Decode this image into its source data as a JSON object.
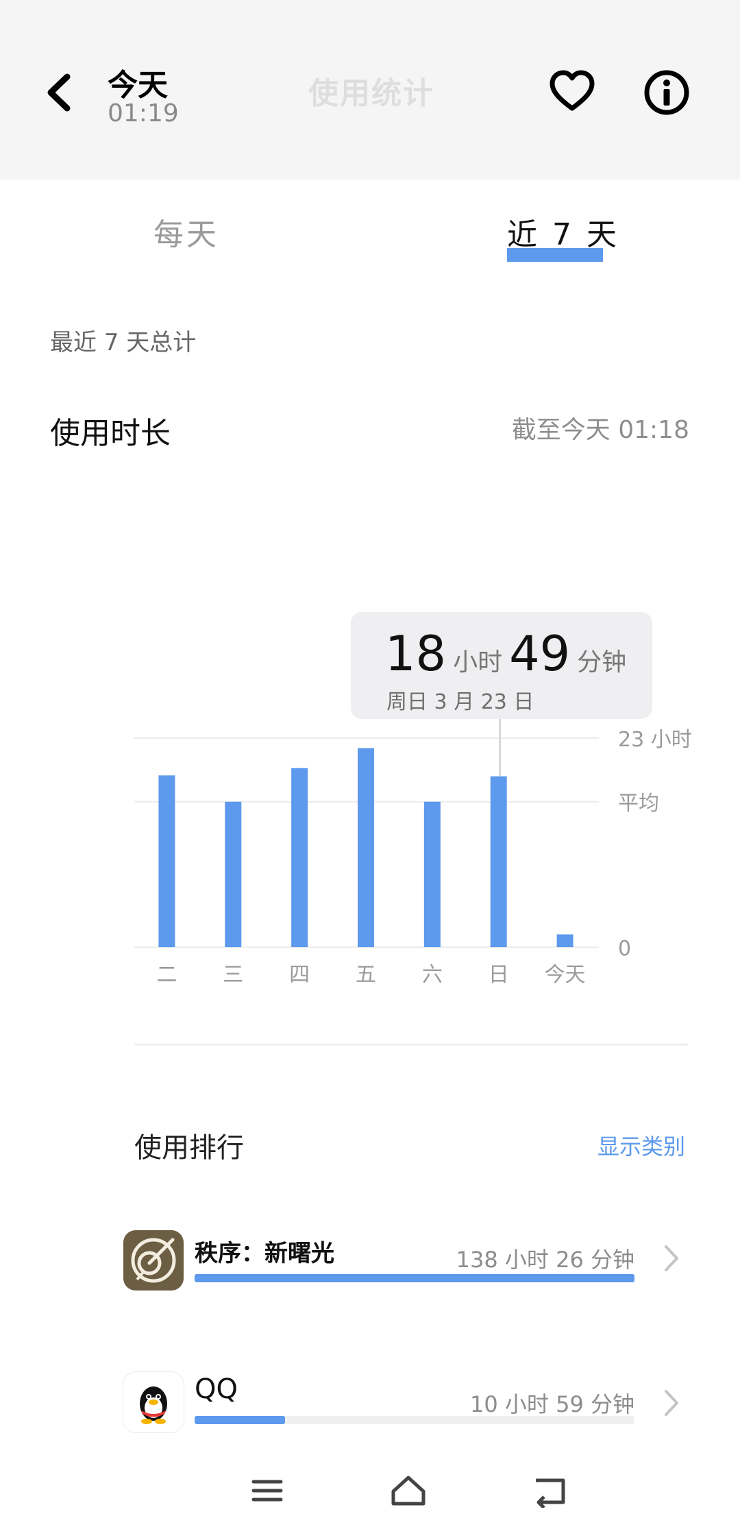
{
  "header": {
    "title": "今天",
    "time": "01:19",
    "center_title": "使用统计"
  },
  "tabs": [
    {
      "label": "每天",
      "selected": false
    },
    {
      "label": "近 7 天",
      "selected": true
    }
  ],
  "summary": {
    "section_label": "最近 7 天总计",
    "usage_title": "使用时长",
    "as_of": "截至今天 01:18"
  },
  "tooltip": {
    "hours": "18",
    "hours_unit": "小时",
    "minutes": "49",
    "minutes_unit": "分钟",
    "date": "周日 3 月 23 日"
  },
  "chart_data": {
    "type": "bar",
    "categories": [
      "二",
      "三",
      "四",
      "五",
      "六",
      "日",
      "今天"
    ],
    "values": [
      18.9,
      16.0,
      19.7,
      21.9,
      16.0,
      18.8,
      1.4
    ],
    "ylim": [
      0,
      23
    ],
    "y_tick_labels": [
      {
        "value": 23,
        "text": "23 小时"
      },
      {
        "value": 16.0,
        "text": "平均"
      },
      {
        "value": 0,
        "text": "0"
      }
    ],
    "selected_category": "日",
    "bar_color": "#5d99ec",
    "grid": true
  },
  "ranking": {
    "title": "使用排行",
    "show_categories": "显示类别",
    "apps": [
      {
        "name": "秩序：新曙光",
        "time": "138 小时 26 分钟",
        "fraction": 1.0,
        "icon": "game-orbit-icon"
      },
      {
        "name": "QQ",
        "time": "10 小时 59 分钟",
        "fraction": 0.206,
        "icon": "qq-penguin-icon"
      }
    ]
  },
  "colors": {
    "accent": "#5d99ec",
    "header_bg": "#f5f5f5",
    "tooltip_bg": "#efeff1"
  },
  "nav": [
    "menu-icon",
    "home-icon",
    "back-icon"
  ]
}
